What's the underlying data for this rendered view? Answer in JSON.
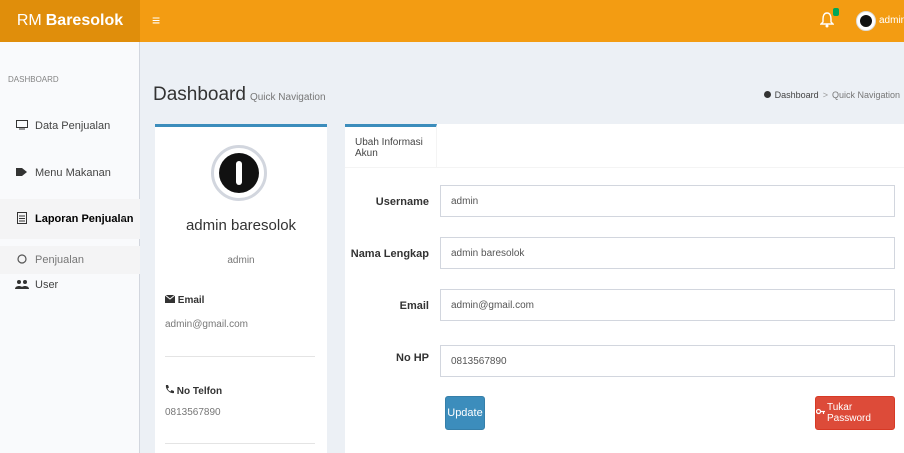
{
  "header": {
    "brand_prefix": "RM",
    "brand_name": "Baresolok",
    "menu_icon": "≡",
    "user_label": "admin"
  },
  "sidebar": {
    "header": "DASHBOARD",
    "items": [
      {
        "label": "Data Penjualan",
        "icon": "monitor-icon"
      },
      {
        "label": "Menu Makanan",
        "icon": "tag-icon"
      },
      {
        "label": "Laporan Penjualan",
        "icon": "document-icon",
        "chevron": "v"
      },
      {
        "label": "Penjualan",
        "icon": "circle-icon"
      },
      {
        "label": "User",
        "icon": "users-icon"
      }
    ]
  },
  "page": {
    "title": "Dashboard",
    "subtitle": "Quick Navigation",
    "breadcrumb": [
      "Dashboard",
      "Quick Navigation"
    ]
  },
  "profile": {
    "name": "admin baresolok",
    "username": "admin",
    "email_label": "Email",
    "email": "admin@gmail.com",
    "phone_label": "No Telfon",
    "phone": "0813567890"
  },
  "form": {
    "tab": "Ubah Informasi Akun",
    "fields": [
      {
        "label": "Username",
        "value": "admin"
      },
      {
        "label": "Nama Lengkap",
        "value": "admin baresolok"
      },
      {
        "label": "Email",
        "value": "admin@gmail.com"
      },
      {
        "label": "No HP",
        "value": "0813567890"
      }
    ],
    "update_label": "Update",
    "password_label": "Tukar Password"
  },
  "colors": {
    "header": "#f39c12",
    "logo_bg": "#e08e0b",
    "primary": "#3c8dbc",
    "danger": "#dd4b39"
  }
}
